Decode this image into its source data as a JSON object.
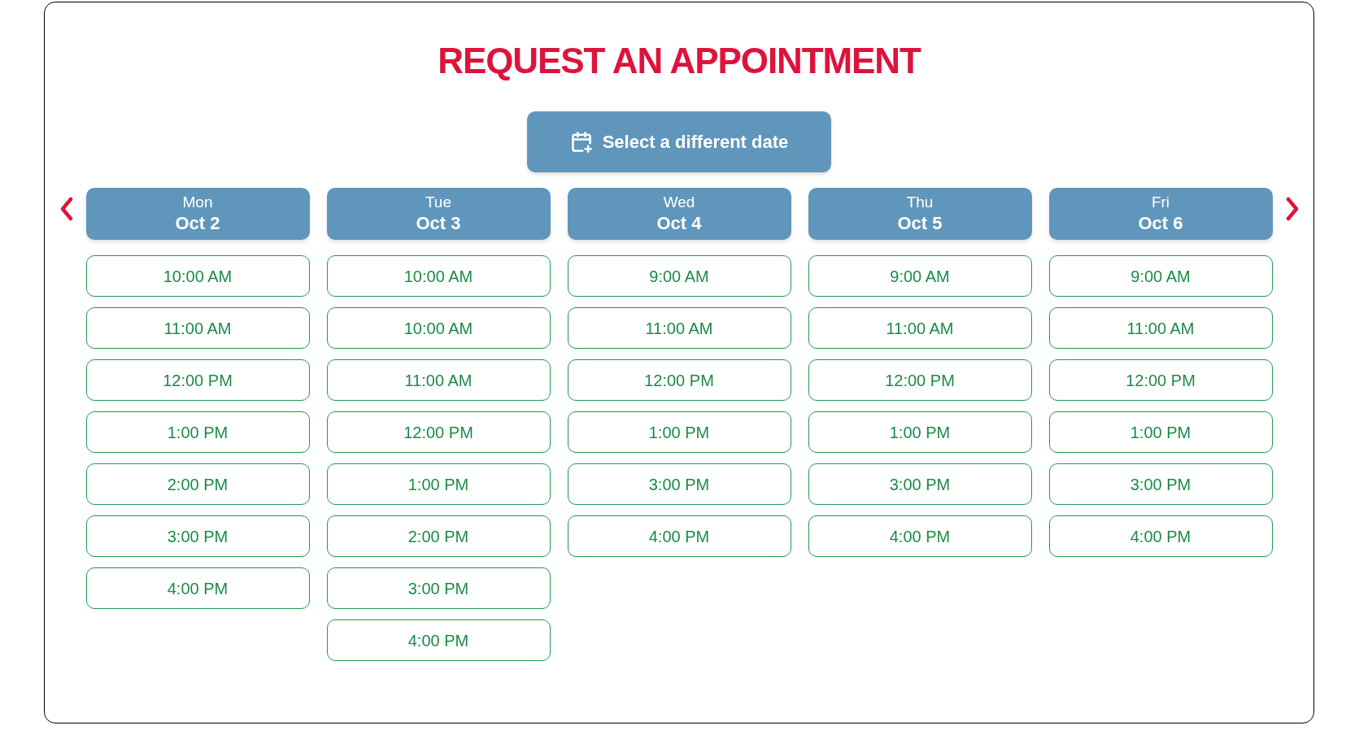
{
  "title": "REQUEST AN APPOINTMENT",
  "date_button": {
    "label": "Select a different date"
  },
  "days": [
    {
      "weekday": "Mon",
      "date": "Oct 2",
      "slots": [
        "10:00 AM",
        "11:00 AM",
        "12:00 PM",
        "1:00 PM",
        "2:00 PM",
        "3:00 PM",
        "4:00 PM"
      ]
    },
    {
      "weekday": "Tue",
      "date": "Oct 3",
      "slots": [
        "10:00 AM",
        "10:00 AM",
        "11:00 AM",
        "12:00 PM",
        "1:00 PM",
        "2:00 PM",
        "3:00 PM",
        "4:00 PM"
      ]
    },
    {
      "weekday": "Wed",
      "date": "Oct 4",
      "slots": [
        "9:00 AM",
        "11:00 AM",
        "12:00 PM",
        "1:00 PM",
        "3:00 PM",
        "4:00 PM"
      ]
    },
    {
      "weekday": "Thu",
      "date": "Oct 5",
      "slots": [
        "9:00 AM",
        "11:00 AM",
        "12:00 PM",
        "1:00 PM",
        "3:00 PM",
        "4:00 PM"
      ]
    },
    {
      "weekday": "Fri",
      "date": "Oct 6",
      "slots": [
        "9:00 AM",
        "11:00 AM",
        "12:00 PM",
        "1:00 PM",
        "3:00 PM",
        "4:00 PM"
      ]
    }
  ]
}
